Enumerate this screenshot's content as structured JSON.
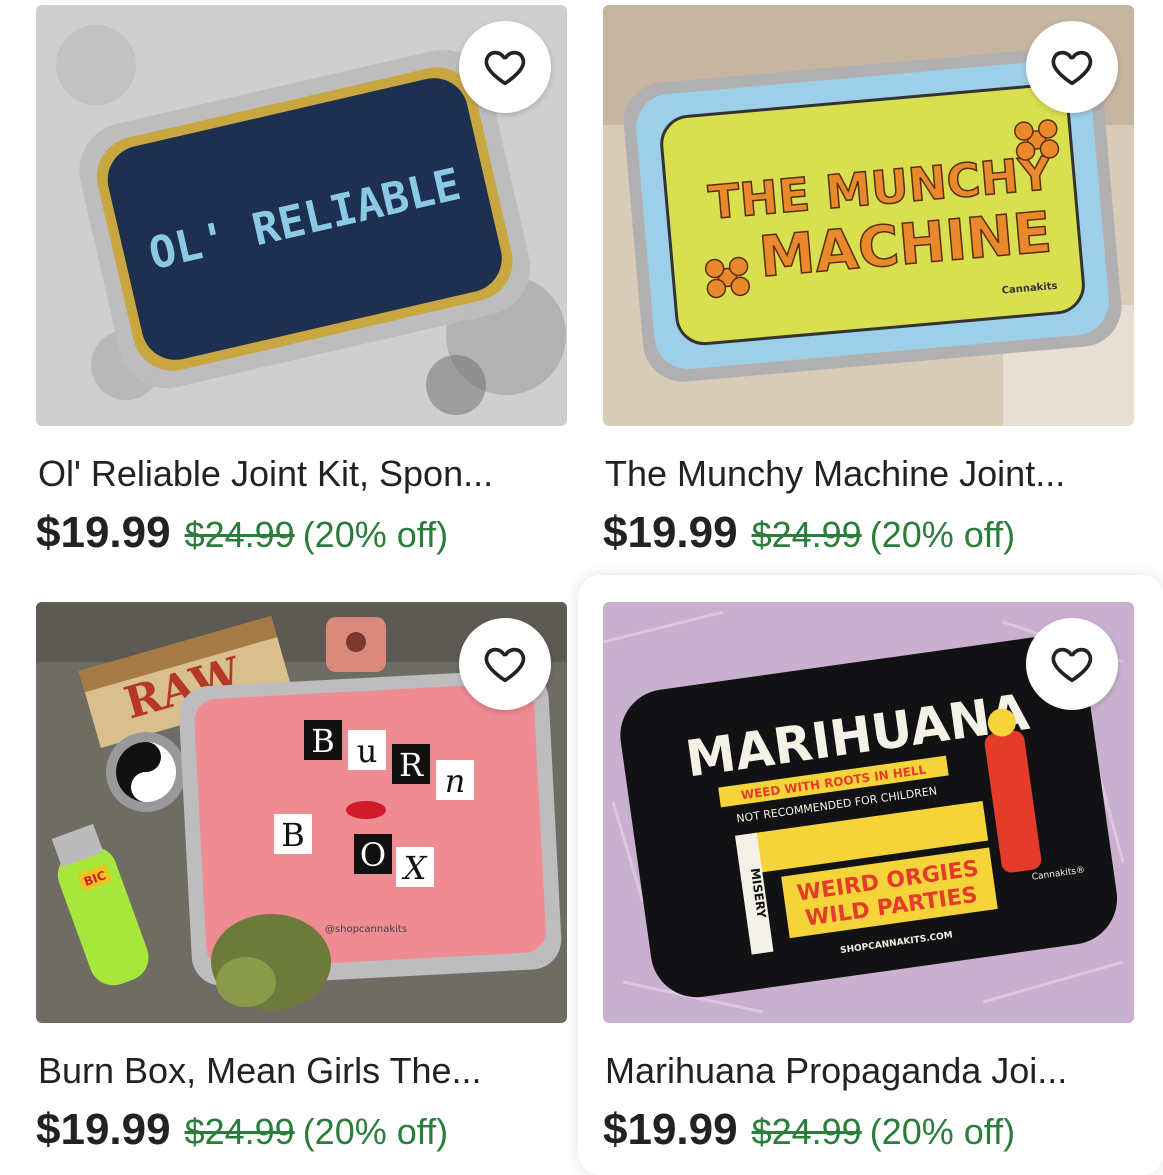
{
  "listings": [
    {
      "title": "Ol' Reliable Joint Kit, Spon...",
      "price": "$19.99",
      "original_price": "$24.99",
      "discount": "(20% off)",
      "image_text": "OL' RELIABLE",
      "favorite_icon": "heart-outline-icon",
      "colors": {
        "label_bg": "#1d3050",
        "label_border": "#c8a640",
        "label_text": "#8cc9e6",
        "background": "#cfcfcf"
      }
    },
    {
      "title": "The Munchy Machine Joint...",
      "price": "$19.99",
      "original_price": "$24.99",
      "discount": "(20% off)",
      "image_text_line1": "THE MUNCHY",
      "image_text_line2": "MACHINE",
      "image_brand": "Cannakits",
      "favorite_icon": "heart-outline-icon",
      "colors": {
        "label_bg": "#d8e050",
        "label_border": "#9dcfe8",
        "label_text": "#e9892b",
        "background": "#d8cbb8"
      }
    },
    {
      "title": "Burn Box, Mean Girls The...",
      "price": "$19.99",
      "original_price": "$24.99",
      "discount": "(20% off)",
      "image_letters_line1": [
        "B",
        "u",
        "R",
        "n"
      ],
      "image_letters_line2": [
        "B",
        "O",
        "X"
      ],
      "image_brand": "@shopcannakits",
      "image_papers_text": "RAW",
      "image_lighter_text": "BIC",
      "favorite_icon": "heart-outline-icon",
      "colors": {
        "label_bg": "#ef8b93",
        "background": "#6f6c64"
      }
    },
    {
      "title": "Marihuana Propaganda Joi...",
      "price": "$19.99",
      "original_price": "$24.99",
      "discount": "(20% off)",
      "image_text_main": "MARIHUANA",
      "image_text_sub": "WEED WITH ROOTS IN HELL",
      "image_text_warning": "NOT RECOMMENDED FOR CHILDREN",
      "image_text_line1": "WEIRD ORGIES",
      "image_text_line2": "WILD PARTIES",
      "image_text_side": "MISERY",
      "image_text_url": "SHOPCANNAKITS.COM",
      "image_brand": "Cannakits®",
      "favorite_icon": "heart-outline-icon",
      "colors": {
        "label_bg": "#121214",
        "accent": "#f5d43a",
        "warning": "#e53b2a",
        "background": "#c9b0cf"
      }
    }
  ],
  "colors": {
    "sale": "#2b7d3c",
    "text": "#222222"
  }
}
